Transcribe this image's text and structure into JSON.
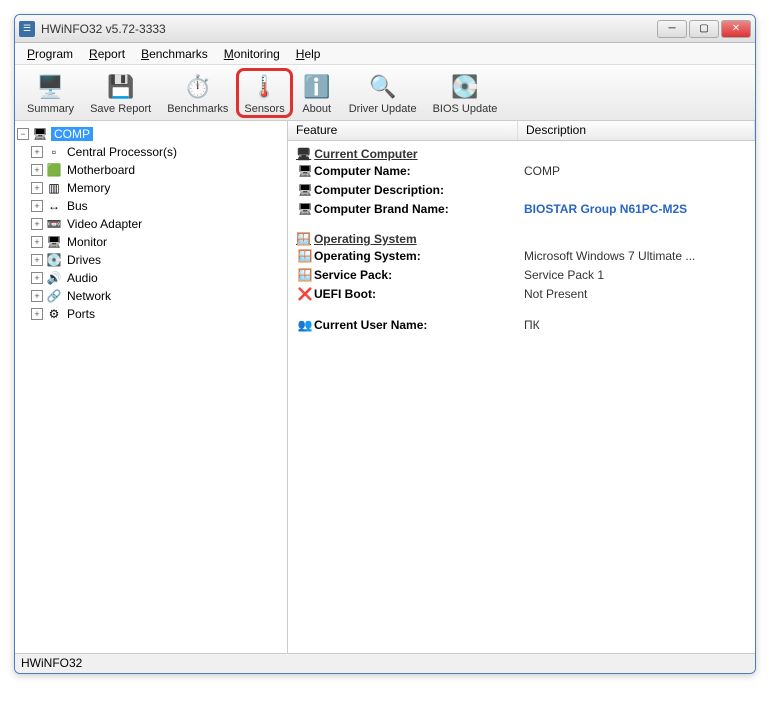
{
  "window": {
    "title": "HWiNFO32 v5.72-3333"
  },
  "menu": {
    "program": "Program",
    "report": "Report",
    "benchmarks": "Benchmarks",
    "monitoring": "Monitoring",
    "help": "Help"
  },
  "toolbar": {
    "summary": "Summary",
    "save_report": "Save Report",
    "benchmarks": "Benchmarks",
    "sensors": "Sensors",
    "about": "About",
    "driver_update": "Driver Update",
    "bios_update": "BIOS Update"
  },
  "tree": {
    "root": "COMP",
    "items": [
      {
        "label": "Central Processor(s)",
        "icon": "▫"
      },
      {
        "label": "Motherboard",
        "icon": "🟩"
      },
      {
        "label": "Memory",
        "icon": "▥"
      },
      {
        "label": "Bus",
        "icon": "↔"
      },
      {
        "label": "Video Adapter",
        "icon": "📼"
      },
      {
        "label": "Monitor",
        "icon": "🖥"
      },
      {
        "label": "Drives",
        "icon": "💽"
      },
      {
        "label": "Audio",
        "icon": "🔊"
      },
      {
        "label": "Network",
        "icon": "🔗"
      },
      {
        "label": "Ports",
        "icon": "⚙"
      }
    ]
  },
  "right": {
    "col_feature": "Feature",
    "col_desc": "Description",
    "sec_current": "Current Computer",
    "rows_current": [
      {
        "icon": "🖥",
        "name": "Computer Name:",
        "value": "COMP",
        "link": false
      },
      {
        "icon": "🖥",
        "name": "Computer Description:",
        "value": "",
        "link": false
      },
      {
        "icon": "🖥",
        "name": "Computer Brand Name:",
        "value": "BIOSTAR Group N61PC-M2S",
        "link": true
      }
    ],
    "sec_os": "Operating System",
    "rows_os": [
      {
        "icon": "🪟",
        "name": "Operating System:",
        "value": "Microsoft Windows 7 Ultimate ..."
      },
      {
        "icon": "🪟",
        "name": "Service Pack:",
        "value": "Service Pack 1"
      },
      {
        "icon": "❌",
        "name": "UEFI Boot:",
        "value": "Not Present"
      }
    ],
    "rows_user": [
      {
        "icon": "👥",
        "name": "Current User Name:",
        "value": "ПК"
      }
    ]
  },
  "statusbar": "HWiNFO32"
}
